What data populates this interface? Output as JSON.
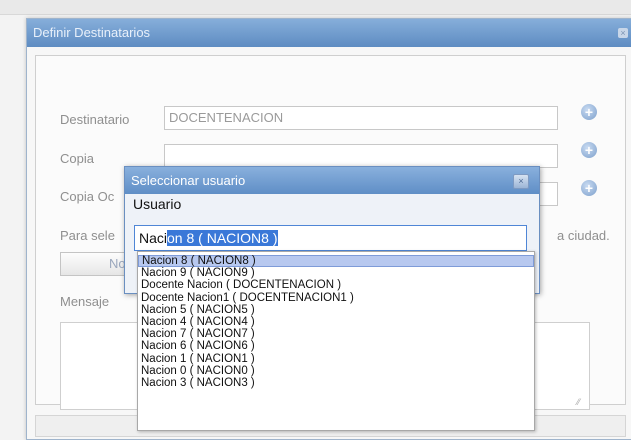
{
  "dialog": {
    "title": "Definir Destinatarios",
    "close_glyph": "×",
    "fields": {
      "destinatario_label": "Destinatario",
      "destinatario_value": "DOCENTENACION",
      "copia_label": "Copia",
      "copia_value": "",
      "copia_oculta_label": "Copia Oc",
      "para_sel_label": "Para sele",
      "ciudad_text": "a ciudad.",
      "partial_button_label": "No",
      "mensaje_label": "Mensaje"
    },
    "add_icon": "plus-icon"
  },
  "popup": {
    "title": "Seleccionar usuario",
    "field_label": "Usuario",
    "search_typed": "Naci",
    "search_autocomplete": "on 8 ( NACION8 )"
  },
  "dropdown": {
    "options": [
      "Nacion 8 ( NACION8 )",
      "Nacion 9 ( NACION9 )",
      "Docente Nacion ( DOCENTENACION )",
      "Docente Nacion1 ( DOCENTENACION1 )",
      "Nacion 5 ( NACION5 )",
      "Nacion 4 ( NACION4 )",
      "Nacion 7 ( NACION7 )",
      "Nacion 6 ( NACION6 )",
      "Nacion 1 ( NACION1 )",
      "Nacion 0 ( NACION0 )",
      "Nacion 3 ( NACION3 )"
    ],
    "highlighted_index": 0
  },
  "colors": {
    "title_bar": "#5e8cc2",
    "selection": "#3a78d8",
    "highlight": "#b7c8ef"
  }
}
